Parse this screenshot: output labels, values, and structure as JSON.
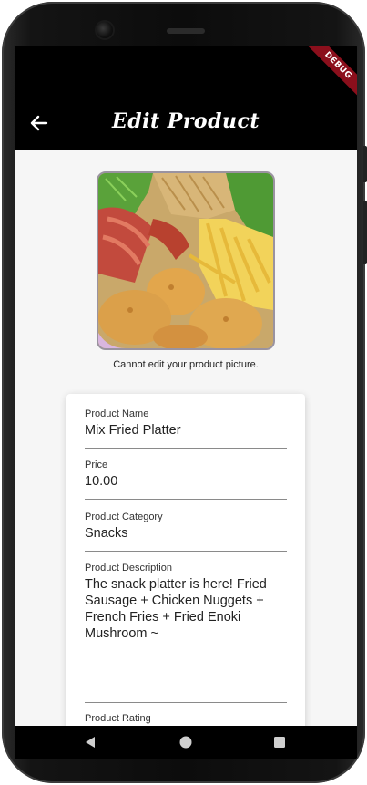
{
  "appbar": {
    "title": "Edit Product",
    "back_icon": "arrow-left-icon"
  },
  "debug_banner": "DEBUG",
  "product_image": {
    "note": "Cannot edit your product picture."
  },
  "form": {
    "fields": [
      {
        "label": "Product Name",
        "value": "Mix Fried Platter"
      },
      {
        "label": "Price",
        "value": "10.00"
      },
      {
        "label": "Product Category",
        "value": "Snacks"
      },
      {
        "label": "Product Description",
        "value": "The snack platter is here! Fried Sausage + Chicken Nuggets + French Fries + Fried Enoki Mushroom ~"
      },
      {
        "label": "Product Rating",
        "value": ""
      }
    ]
  },
  "navbar": {
    "icons": [
      "back-triangle-icon",
      "home-circle-icon",
      "recents-square-icon"
    ]
  },
  "colors": {
    "appbar": "#000000",
    "content_bg": "#f6f6f6",
    "debug_ribbon": "#8b0f1c"
  }
}
